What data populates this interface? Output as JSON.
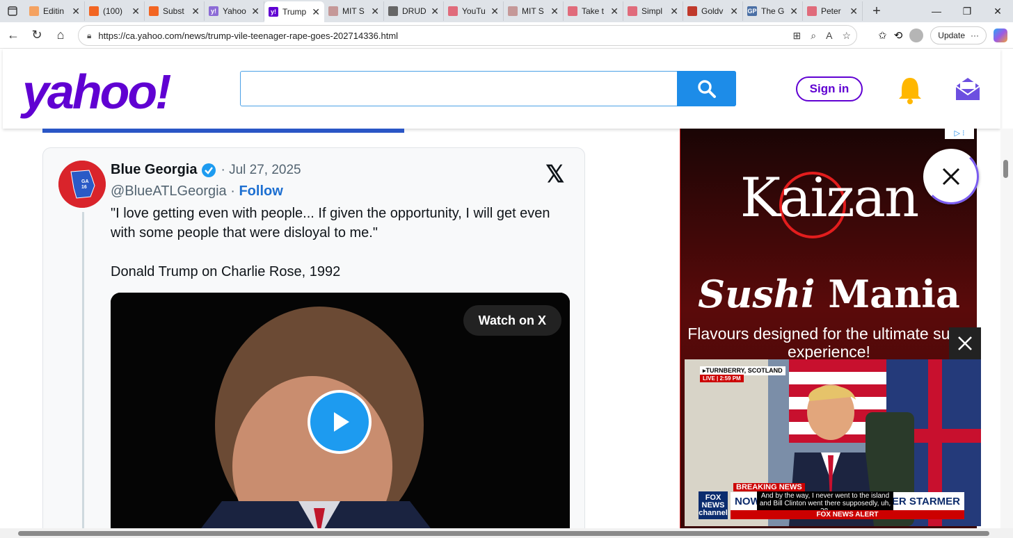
{
  "browser": {
    "tabs": [
      {
        "label": "Editin",
        "fav_color": "#f4a261",
        "fav_glyph": ""
      },
      {
        "label": "(100)",
        "fav_color": "#f26522",
        "fav_glyph": ""
      },
      {
        "label": "Subst",
        "fav_color": "#f26522",
        "fav_glyph": ""
      },
      {
        "label": "Yahoo",
        "fav_color": "#8c6bd6",
        "fav_glyph": "y!"
      },
      {
        "label": "Trump",
        "fav_color": "#6001d2",
        "fav_glyph": "y!",
        "active": true
      },
      {
        "label": "MIT S",
        "fav_color": "#c59898",
        "fav_glyph": ""
      },
      {
        "label": "DRUD",
        "fav_color": "#666666",
        "fav_glyph": ""
      },
      {
        "label": "YouTu",
        "fav_color": "#e06b7b",
        "fav_glyph": ""
      },
      {
        "label": "MIT S",
        "fav_color": "#c59898",
        "fav_glyph": ""
      },
      {
        "label": "Take t",
        "fav_color": "#e06b7b",
        "fav_glyph": ""
      },
      {
        "label": "Simpl",
        "fav_color": "#e06b7b",
        "fav_glyph": ""
      },
      {
        "label": "Goldv",
        "fav_color": "#c0392b",
        "fav_glyph": ""
      },
      {
        "label": "The G",
        "fav_color": "#4a6fa5",
        "fav_glyph": "GP"
      },
      {
        "label": "Peter",
        "fav_color": "#e06b7b",
        "fav_glyph": ""
      }
    ],
    "close_glyph": "✕",
    "new_tab_glyph": "+",
    "url": "https://ca.yahoo.com/news/trump-vile-teenager-rape-goes-202714336.html",
    "update_label": "Update",
    "more_label": "···"
  },
  "yahoo": {
    "logo": "yahoo!",
    "search_placeholder": "",
    "signin_label": "Sign in"
  },
  "tweet": {
    "name": "Blue Georgia",
    "date": "· Jul 27, 2025",
    "handle": "@BlueATLGeorgia",
    "separator": " · ",
    "follow": "Follow",
    "text_1": "\"I love getting even with people... If given the opportunity, I will get even with some people that were disloyal to me.\"",
    "text_2": "Donald Trump on Charlie Rose, 1992",
    "watch_label": "Watch on X",
    "x_logo": "𝕏"
  },
  "ad": {
    "brand": "Kaizan",
    "headline_em": "Sushi",
    "headline_rest": " Mania",
    "sub": "Flavours designed for the ultimate sushi experience!",
    "adchoices": "▷ ⁝"
  },
  "pip": {
    "location": "▸TURNBERRY, SCOTLAND",
    "live": "LIVE | 2:59 PM",
    "breaking": "BREAKING NEWS",
    "now_left": "NOW: T",
    "now_right": "ISTER STARMER",
    "caption": "And by the way, I never went to the island and Bill Clinton went there supposedly, uh, 28,",
    "alert": "FOX NEWS ALERT",
    "fox": "FOX NEWS channel"
  }
}
